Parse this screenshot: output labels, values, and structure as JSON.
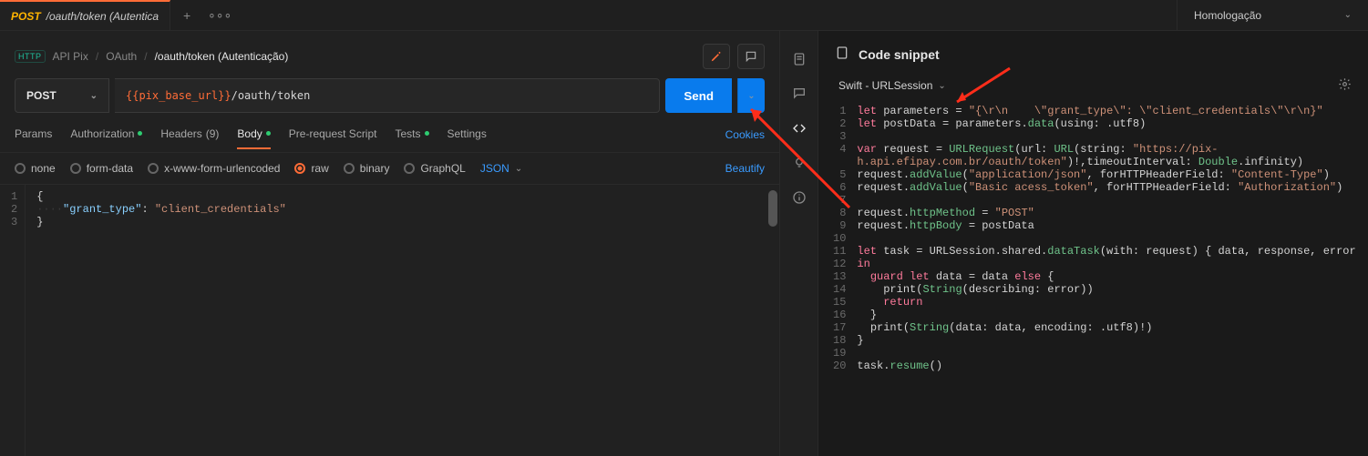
{
  "tab": {
    "method": "POST",
    "title": "/oauth/token (Autentica"
  },
  "env": {
    "name": "Homologação"
  },
  "breadcrumb": {
    "root": "API Pix",
    "mid": "OAuth",
    "last": "/oauth/token (Autenticação)"
  },
  "request": {
    "method": "POST",
    "url_var": "{{pix_base_url}}",
    "url_path": "/oauth/token",
    "send_label": "Send"
  },
  "reqtabs": {
    "params": "Params",
    "auth": "Authorization",
    "headers_label": "Headers",
    "headers_count": "(9)",
    "body": "Body",
    "prescript": "Pre-request Script",
    "tests": "Tests",
    "settings": "Settings",
    "cookies": "Cookies"
  },
  "bodytypes": {
    "none": "none",
    "formdata": "form-data",
    "xwww": "x-www-form-urlencoded",
    "raw": "raw",
    "binary": "binary",
    "graphql": "GraphQL",
    "subtype": "JSON",
    "beautify": "Beautify"
  },
  "editor": {
    "lines": [
      "1",
      "2",
      "3"
    ],
    "l1": "{",
    "l2_key": "\"grant_type\"",
    "l2_val": "\"client_credentials\"",
    "l3": "}"
  },
  "snippet": {
    "title": "Code snippet",
    "lang": "Swift - URLSession",
    "gutter": " 1\n 2\n 3\n 4\n\n 5\n 6\n 7\n 8\n 9\n10\n11\n12\n13\n14\n15\n16\n17\n18\n19\n20",
    "code": {
      "l1": {
        "a": "let",
        "b": " parameters = ",
        "c": "\"{\\r\\n    \\\"grant_type\\\": \\\"client_credentials\\\"\\r\\n}\""
      },
      "l2": {
        "a": "let",
        "b": " postData = parameters.",
        "c": "data",
        "d": "(using: .utf8)"
      },
      "l4": {
        "a": "var",
        "b": " request = ",
        "c": "URLRequest",
        "d": "(url: ",
        "e": "URL",
        "f": "(string: ",
        "g": "\"https://pix-h.api.efipay.com.br/oauth/token\"",
        "h": ")!,timeoutInterval: ",
        "i": "Double",
        "j": ".infinity)"
      },
      "l5": {
        "a": "request.",
        "b": "addValue",
        "c": "(",
        "d": "\"application/json\"",
        "e": ", forHTTPHeaderField: ",
        "f": "\"Content-Type\"",
        "g": ")"
      },
      "l6": {
        "a": "request.",
        "b": "addValue",
        "c": "(",
        "d": "\"Basic acess_token\"",
        "e": ", forHTTPHeaderField: ",
        "f": "\"Authorization\"",
        "g": ")"
      },
      "l8": {
        "a": "request.",
        "b": "httpMethod",
        "c": " = ",
        "d": "\"POST\""
      },
      "l9": {
        "a": "request.",
        "b": "httpBody",
        "c": " = postData"
      },
      "l11": {
        "a": "let",
        "b": " task = URLSession.shared.",
        "c": "dataTask",
        "d": "(with: request) { data, response, error ",
        "e": "in"
      },
      "l12": {
        "a": "  guard let",
        "b": " data = data ",
        "c": "else",
        "d": " {"
      },
      "l13": {
        "a": "    print(",
        "b": "String",
        "c": "(describing: error))"
      },
      "l14": "    return",
      "l15": "  }",
      "l16": {
        "a": "  print(",
        "b": "String",
        "c": "(data: data, encoding: .utf8)!)"
      },
      "l17": "}",
      "l19": {
        "a": "task.",
        "b": "resume",
        "c": "()"
      }
    }
  }
}
